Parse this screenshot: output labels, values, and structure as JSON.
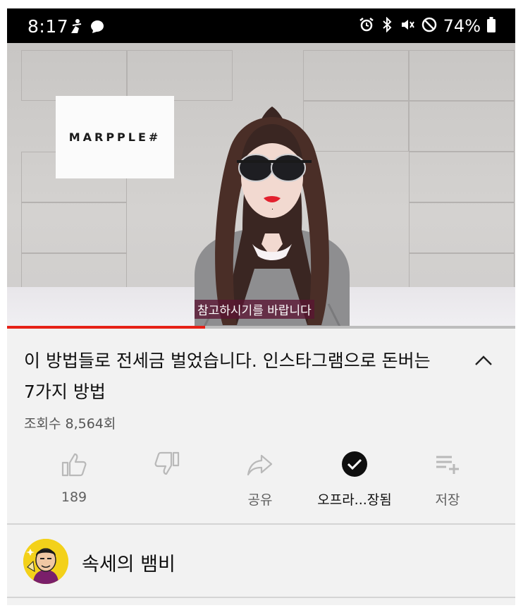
{
  "status_bar": {
    "time": "8:17",
    "battery": "74%",
    "icons_left": [
      "accessibility-icon",
      "chat-bubble-icon"
    ],
    "icons_right": [
      "alarm-icon",
      "bluetooth-icon",
      "mute-icon",
      "do-not-disturb-icon",
      "battery-icon"
    ]
  },
  "video": {
    "brand": "MARPPLE#",
    "caption": "참고하시기를 바랍니다",
    "progress_fraction": 0.39
  },
  "info": {
    "title": "이 방법들로 전세금 벌었습니다. 인스타그램으로 돈버는 7가지 방법",
    "views": "조회수 8,564회"
  },
  "actions": {
    "like": {
      "icon": "thumbs-up-icon",
      "label": "189"
    },
    "dislike": {
      "icon": "thumbs-down-icon",
      "label": ""
    },
    "share": {
      "icon": "share-icon",
      "label": "공유"
    },
    "offline": {
      "icon": "check-circle-icon",
      "label": "오프라...장됨"
    },
    "save": {
      "icon": "playlist-add-icon",
      "label": "저장"
    }
  },
  "channel": {
    "name": "속세의 뱀비"
  },
  "colors": {
    "progress": "#e62117",
    "background": "#f2f2f2",
    "status_bar": "#000000"
  }
}
